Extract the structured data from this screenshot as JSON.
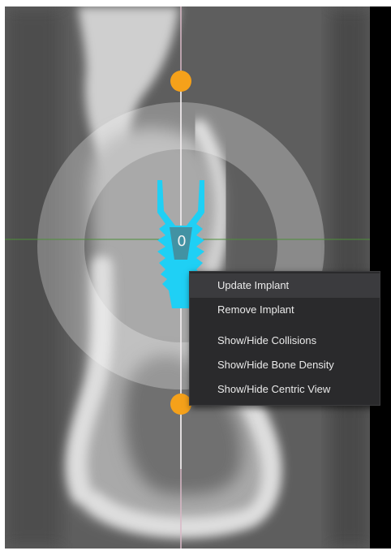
{
  "viewport": {
    "center_marker_label": "0"
  },
  "context_menu": {
    "items": [
      {
        "label": "Update Implant",
        "highlighted": true
      },
      {
        "label": "Remove Implant",
        "highlighted": false
      },
      {
        "label": "Show/Hide Collisions",
        "highlighted": false
      },
      {
        "label": "Show/Hide Bone Density",
        "highlighted": false
      },
      {
        "label": "Show/Hide Centric View",
        "highlighted": false
      }
    ]
  },
  "colors": {
    "implant": "#1fd0f5",
    "handle": "#f5a11a",
    "axis_line": "#d9b8c6",
    "horizontal_guide": "#4f8f3a",
    "menu_bg": "#2a2a2c"
  },
  "icons": {
    "top_handle": "orange-circle-handle",
    "bottom_handle": "orange-circle-handle"
  }
}
